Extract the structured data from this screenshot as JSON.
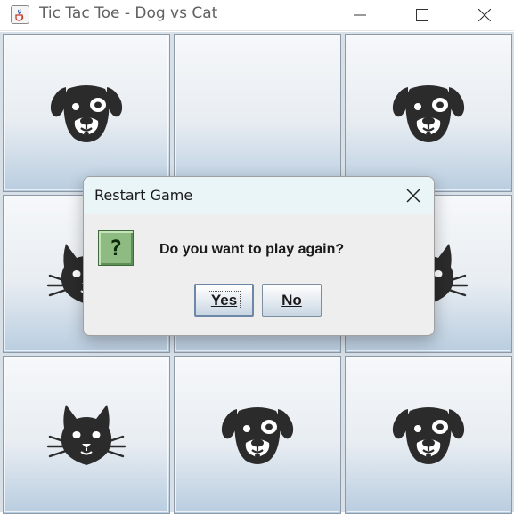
{
  "window": {
    "title": "Tic Tac Toe - Dog vs Cat",
    "app_icon": "java-coffee-icon",
    "controls": [
      "minimize-icon",
      "maximize-icon",
      "close-icon"
    ]
  },
  "board": {
    "cells": [
      "dog",
      "empty",
      "dog",
      "cat",
      "empty",
      "cat",
      "cat",
      "dog",
      "dog"
    ]
  },
  "dialog": {
    "title": "Restart Game",
    "icon": "question-icon",
    "icon_glyph": "?",
    "message": "Do you want to play again?",
    "buttons": {
      "yes_label": "Yes",
      "no_label": "No"
    }
  },
  "colors": {
    "dialog_title_bg": "#eaf5f7",
    "question_icon_bg": "#8dbb81",
    "piece": "#2b2b2b"
  }
}
